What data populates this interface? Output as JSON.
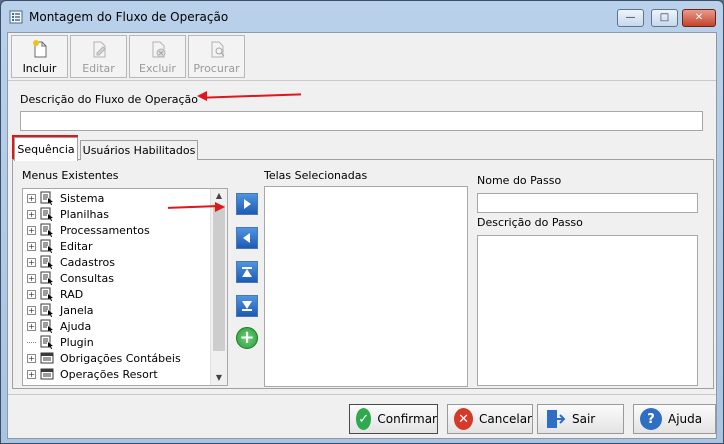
{
  "window": {
    "title": "Montagem do Fluxo de Operação",
    "controls": {
      "minimize": "—",
      "maximize": "□",
      "close": "✕"
    }
  },
  "toolbar": {
    "buttons": [
      {
        "label": "Incluir",
        "icon": "new-document-icon",
        "enabled": true
      },
      {
        "label": "Editar",
        "icon": "edit-document-icon",
        "enabled": false
      },
      {
        "label": "Excluir",
        "icon": "delete-document-icon",
        "enabled": false
      },
      {
        "label": "Procurar",
        "icon": "search-document-icon",
        "enabled": false
      }
    ]
  },
  "description": {
    "label": "Descrição do Fluxo de Operação",
    "value": ""
  },
  "tabs": [
    {
      "label": "Sequência",
      "active": true
    },
    {
      "label": "Usuários Habilitados",
      "active": false
    }
  ],
  "menus": {
    "label": "Menus Existentes",
    "items": [
      {
        "label": "Sistema",
        "expandable": true,
        "icon": "menu-cursor-icon"
      },
      {
        "label": "Planilhas",
        "expandable": true,
        "icon": "menu-cursor-icon"
      },
      {
        "label": "Processamentos",
        "expandable": true,
        "icon": "menu-cursor-icon"
      },
      {
        "label": "Editar",
        "expandable": true,
        "icon": "menu-cursor-icon"
      },
      {
        "label": "Cadastros",
        "expandable": true,
        "icon": "menu-cursor-icon"
      },
      {
        "label": "Consultas",
        "expandable": true,
        "icon": "menu-cursor-icon"
      },
      {
        "label": "RAD",
        "expandable": true,
        "icon": "menu-cursor-icon"
      },
      {
        "label": "Janela",
        "expandable": true,
        "icon": "menu-cursor-icon"
      },
      {
        "label": "Ajuda",
        "expandable": true,
        "icon": "menu-cursor-icon"
      },
      {
        "label": "Plugin",
        "expandable": false,
        "icon": "menu-cursor-icon"
      },
      {
        "label": "Obrigações Contábeis",
        "expandable": true,
        "icon": "module-grid-icon"
      },
      {
        "label": "Operações Resort",
        "expandable": true,
        "icon": "module-grid-icon"
      }
    ]
  },
  "selected_screens": {
    "label": "Telas Selecionadas",
    "items": []
  },
  "step": {
    "name_label": "Nome do Passo",
    "name_value": "",
    "desc_label": "Descrição do Passo",
    "desc_value": ""
  },
  "footer": {
    "confirm": "Confirmar",
    "cancel": "Cancelar",
    "exit": "Sair",
    "help": "Ajuda"
  },
  "colors": {
    "annotation": "#e0161b",
    "arrow_button": "#1c5bb5",
    "add_button": "#2a9a3a"
  }
}
